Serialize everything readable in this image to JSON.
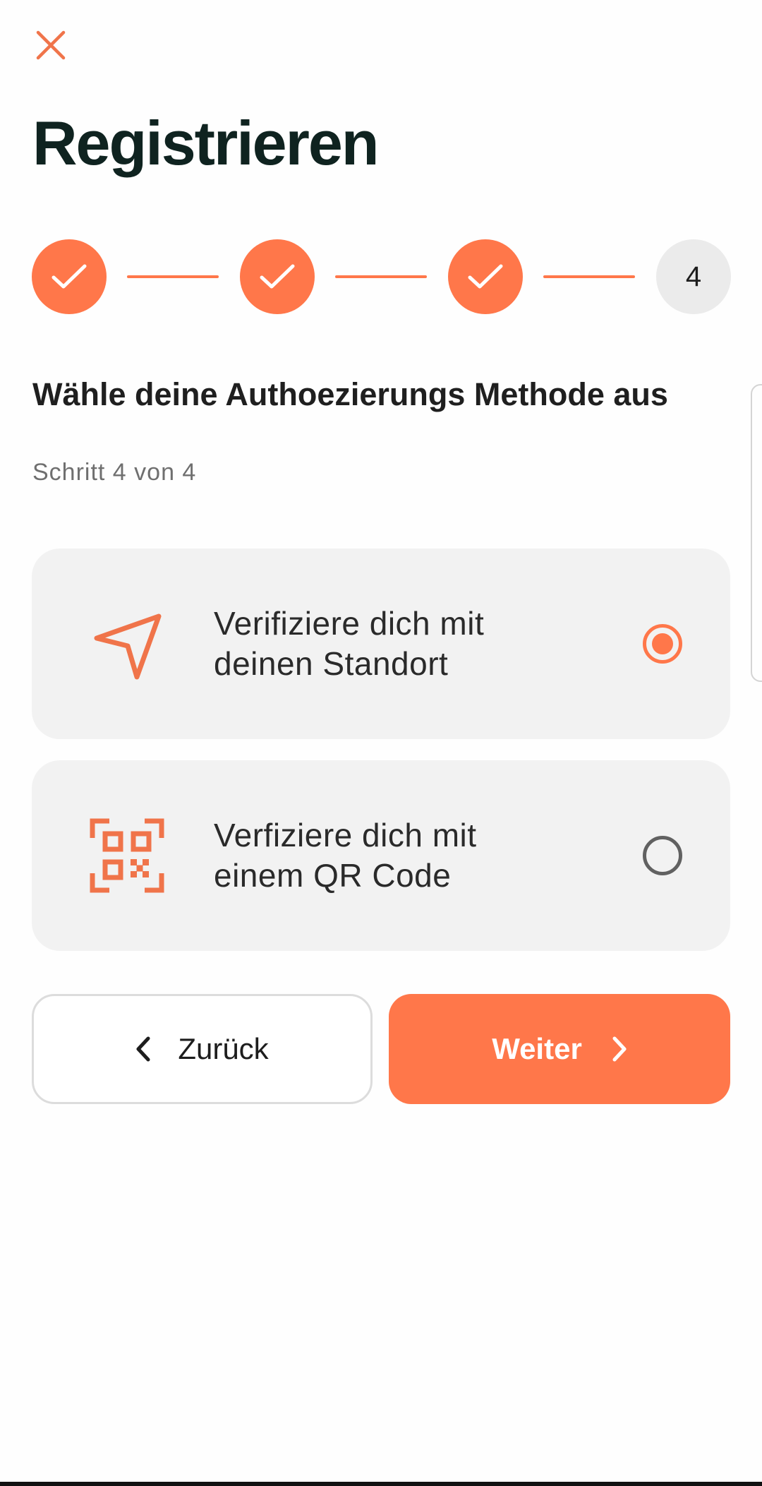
{
  "header": {
    "close_icon": "close-icon",
    "title": "Registrieren"
  },
  "stepper": {
    "total_steps": 4,
    "completed_steps": 3,
    "current_step_label": "4",
    "accent_color": "#ff774a"
  },
  "section": {
    "title": "Wähle deine Authoezierungs Methode aus",
    "subtitle": "Schritt 4 von 4"
  },
  "options": [
    {
      "icon": "location-arrow-icon",
      "label_line1": "Verifiziere dich mit",
      "label_line2": "deinen Standort",
      "selected": true
    },
    {
      "icon": "qr-code-icon",
      "label_line1": "Verfiziere dich mit",
      "label_line2": "einem QR Code",
      "selected": false
    }
  ],
  "actions": {
    "back_label": "Zurück",
    "back_icon": "chevron-left-icon",
    "next_label": "Weiter",
    "next_icon": "chevron-right-icon"
  },
  "colors": {
    "accent": "#ff774a",
    "title": "#0f2320",
    "card_background": "#f2f2f2"
  }
}
